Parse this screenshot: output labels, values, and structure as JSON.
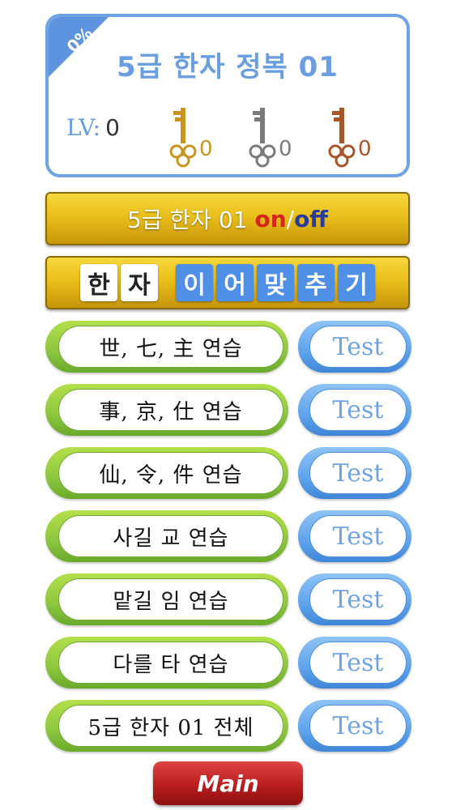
{
  "header": {
    "progress": "0%",
    "title": "5급 한자 정복 01",
    "level_label": "LV:",
    "level_value": "0",
    "keys": [
      {
        "name": "gold-key",
        "color": "#c8951e",
        "count": "0"
      },
      {
        "name": "silver-key",
        "color": "#7a7a7a",
        "count": "0"
      },
      {
        "name": "bronze-key",
        "color": "#a8552a",
        "count": "0"
      }
    ]
  },
  "toggle": {
    "prefix": "5급 한자 01 ",
    "on": "on",
    "slash": "/",
    "off": "off"
  },
  "game": {
    "white_tiles": [
      "한",
      "자"
    ],
    "blue_tiles": [
      "이",
      "어",
      "맞",
      "추",
      "기"
    ]
  },
  "practice": [
    {
      "label": "世, 七, 主 연습",
      "test": "Test"
    },
    {
      "label": "事, 京, 仕 연습",
      "test": "Test"
    },
    {
      "label": "仙, 令, 件 연습",
      "test": "Test"
    },
    {
      "label": "사길 교 연습",
      "test": "Test"
    },
    {
      "label": "맡길 임 연습",
      "test": "Test"
    },
    {
      "label": "다를 타 연습",
      "test": "Test"
    },
    {
      "label": "5급 한자 01 전체",
      "test": "Test"
    }
  ],
  "main_button": "Main",
  "colors": {
    "card_border": "#6fa3e6",
    "gold": "#eabf1a",
    "green": "#8cc63f",
    "blue": "#5fa3ec",
    "red": "#b81e1e"
  }
}
